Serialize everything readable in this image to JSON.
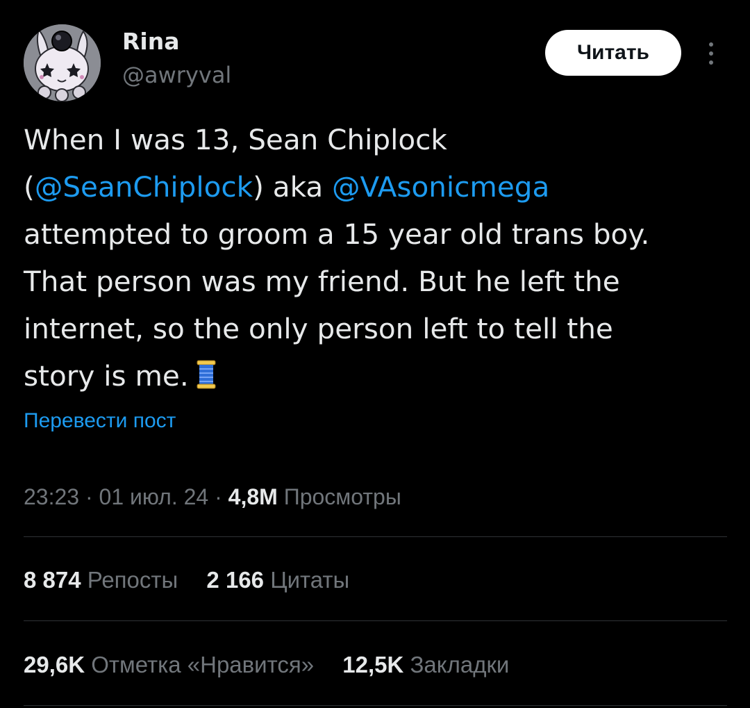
{
  "author": {
    "name": "Rina",
    "handle": "@awryval",
    "follow_label": "Читать",
    "avatar_icon": "avatar-bunny-icon"
  },
  "tweet": {
    "lines": [
      [
        "When I was 13, Sean Chiplock"
      ],
      [
        "(",
        "@SeanChiplock",
        ") aka ",
        "@VAsonicmega"
      ],
      [
        "attempted to groom a 15 year old trans boy."
      ],
      [
        "That person was my friend. But he left the"
      ],
      [
        "internet, so the only person left to tell the"
      ],
      [
        "story is me."
      ]
    ],
    "emoji": "spool-of-thread-icon",
    "translate_label": "Перевести пост"
  },
  "meta": {
    "time": "23:23",
    "separator": "·",
    "date": "01 июл. 24",
    "views_count": "4,8M",
    "views_label": "Просмотры"
  },
  "stats": {
    "reposts_count": "8 874",
    "reposts_label": "Репосты",
    "quotes_count": "2 166",
    "quotes_label": "Цитаты",
    "likes_count": "29,6K",
    "likes_label": "Отметка «Нравится»",
    "bookmarks_count": "12,5K",
    "bookmarks_label": "Закладки"
  },
  "colors": {
    "background": "#000000",
    "text_primary": "#e7e9ea",
    "text_secondary": "#71767b",
    "link": "#1d9bf0",
    "divider": "#2f3336",
    "button_bg": "#ffffff"
  }
}
